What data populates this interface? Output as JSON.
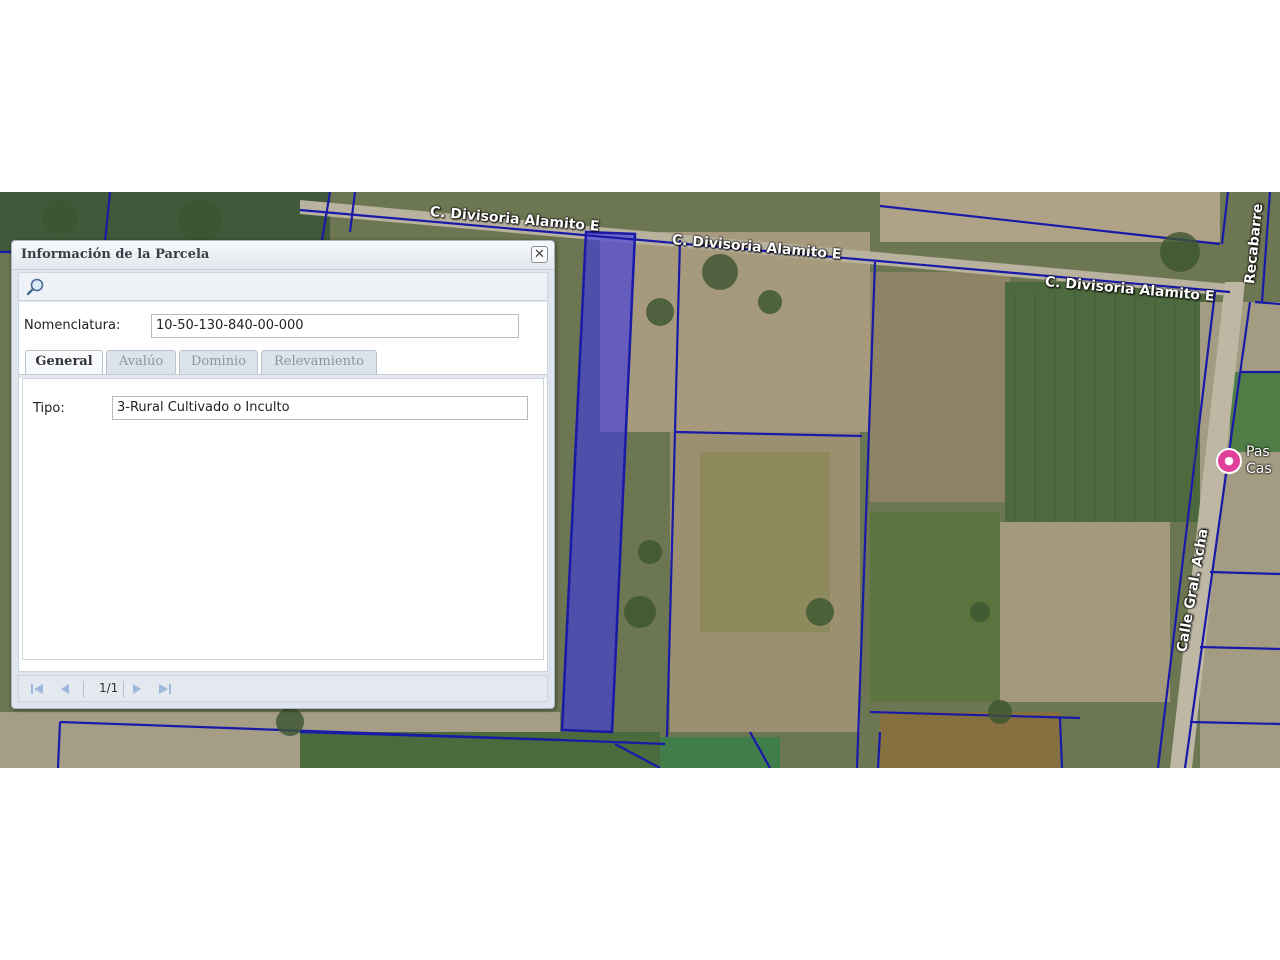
{
  "map": {
    "road_labels": {
      "divisoria_1": "C. Divisoria Alamito E",
      "divisoria_2": "C. Divisoria Alamito E",
      "divisoria_3": "C. Divisoria Alamito E",
      "recabarren": "Recabarre",
      "gral_acha": "Calle Gral. Acha"
    },
    "poi": {
      "icon": "pin-icon",
      "label": "Pas\nCas"
    },
    "colors": {
      "parcel_line": "#1a1aa8",
      "selected_fill": "#3a34e8"
    }
  },
  "dialog": {
    "title": "Información de la Parcela",
    "close_icon": "close-icon",
    "toolbar": {
      "search_icon": "magnifier-icon"
    },
    "nomenclatura": {
      "label": "Nomenclatura:",
      "value": "10-50-130-840-00-000"
    },
    "tabs": [
      {
        "label": "General",
        "active": true
      },
      {
        "label": "Avalúo",
        "active": false
      },
      {
        "label": "Dominio",
        "active": false
      },
      {
        "label": "Relevamiento",
        "active": false
      }
    ],
    "general": {
      "tipo_label": "Tipo:",
      "tipo_value": "3-Rural Cultivado o Inculto"
    },
    "pager": {
      "page_info": "1/1"
    }
  }
}
